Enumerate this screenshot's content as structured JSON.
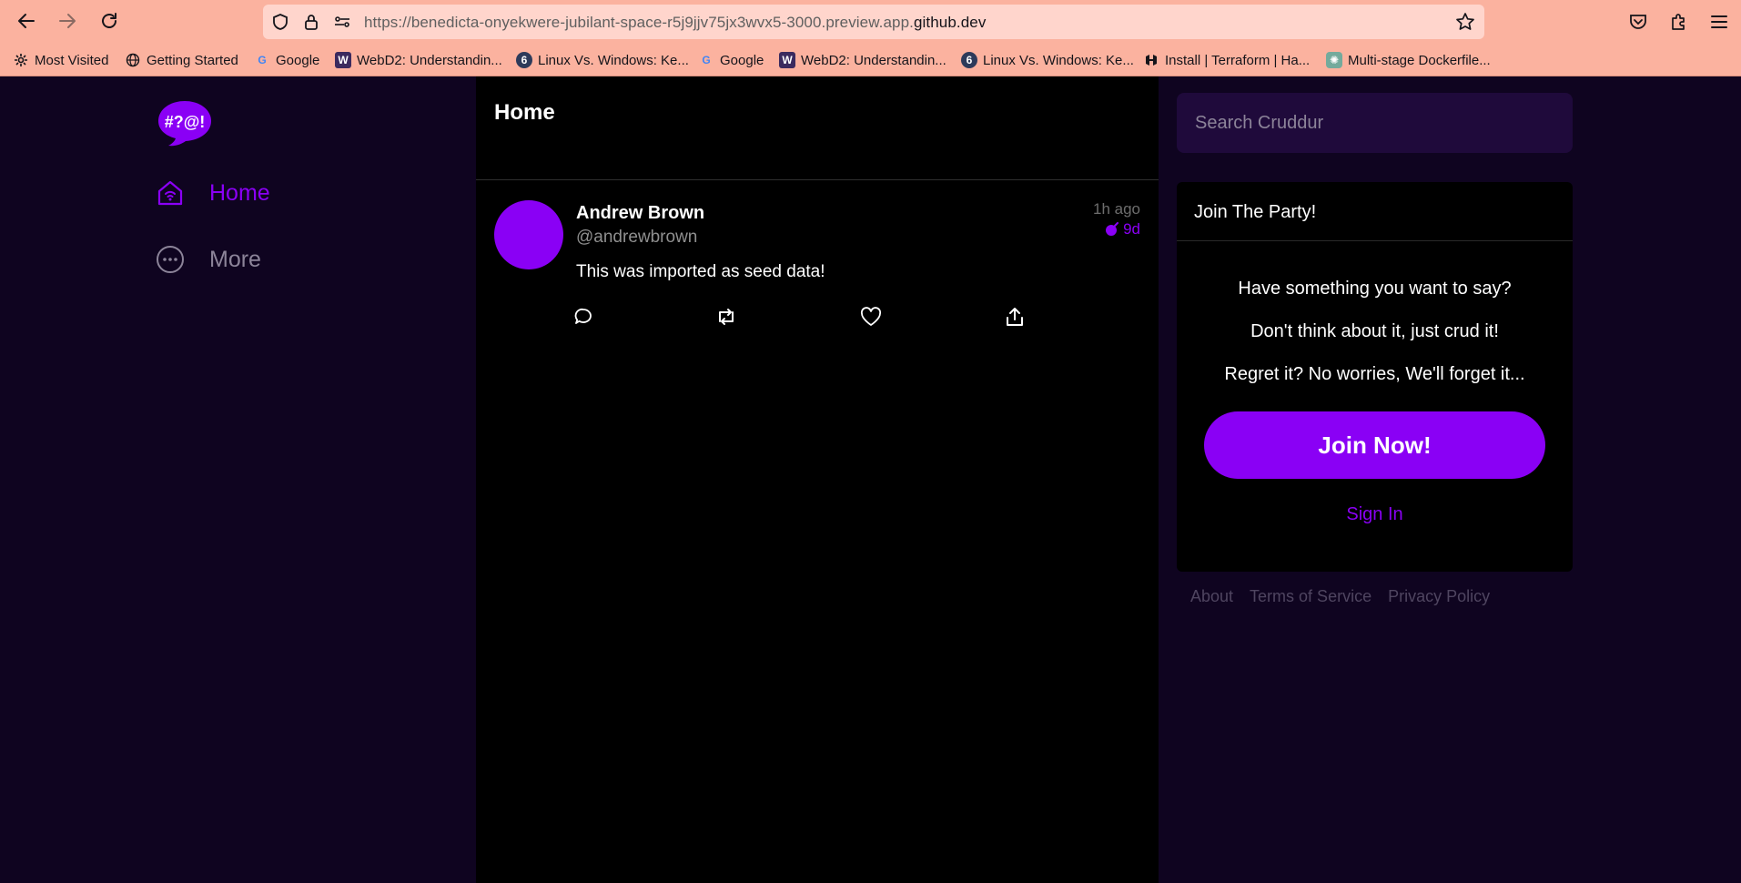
{
  "browser": {
    "url_prefix": "https://benedicta-onyekwere-jubilant-space-r5j9jjv75jx3wvx5-3000.preview.app.",
    "url_domain": "github.dev",
    "bookmarks": [
      {
        "label": "Most Visited",
        "icon": "gear-icon"
      },
      {
        "label": "Getting Started",
        "icon": "globe-icon"
      },
      {
        "label": "Google",
        "icon": "google-icon"
      },
      {
        "label": "WebD2: Understandin...",
        "icon": "webd2-icon"
      },
      {
        "label": "Linux Vs. Windows: Ke...",
        "icon": "linux-icon"
      },
      {
        "label": "Google",
        "icon": "google-icon"
      },
      {
        "label": "WebD2: Understandin...",
        "icon": "webd2-icon"
      },
      {
        "label": "Linux Vs. Windows: Ke...",
        "icon": "linux-icon"
      },
      {
        "label": "Install | Terraform | Ha...",
        "icon": "hashicorp-icon"
      },
      {
        "label": "Multi-stage Dockerfile...",
        "icon": "openai-icon"
      }
    ]
  },
  "logo_text": "#?@!",
  "sidebar": {
    "items": [
      {
        "label": "Home",
        "icon": "home-icon",
        "active": true
      },
      {
        "label": "More",
        "icon": "more-icon",
        "active": false
      }
    ]
  },
  "feed": {
    "title": "Home",
    "activities": [
      {
        "display_name": "Andrew Brown",
        "handle": "@andrewbrown",
        "created": "1h ago",
        "expires": "9d",
        "message": "This was imported as seed data!"
      }
    ]
  },
  "search": {
    "placeholder": "Search Cruddur"
  },
  "join": {
    "title": "Join The Party!",
    "lines": [
      "Have something you want to say?",
      "Don't think about it, just crud it!",
      "Regret it? No worries, We'll forget it..."
    ],
    "button": "Join Now!",
    "signin": "Sign In"
  },
  "footer": {
    "links": [
      "About",
      "Terms of Service",
      "Privacy Policy"
    ]
  },
  "colors": {
    "accent": "#8a00f5",
    "background": "#0f0420",
    "chrome": "#fbb29f"
  }
}
